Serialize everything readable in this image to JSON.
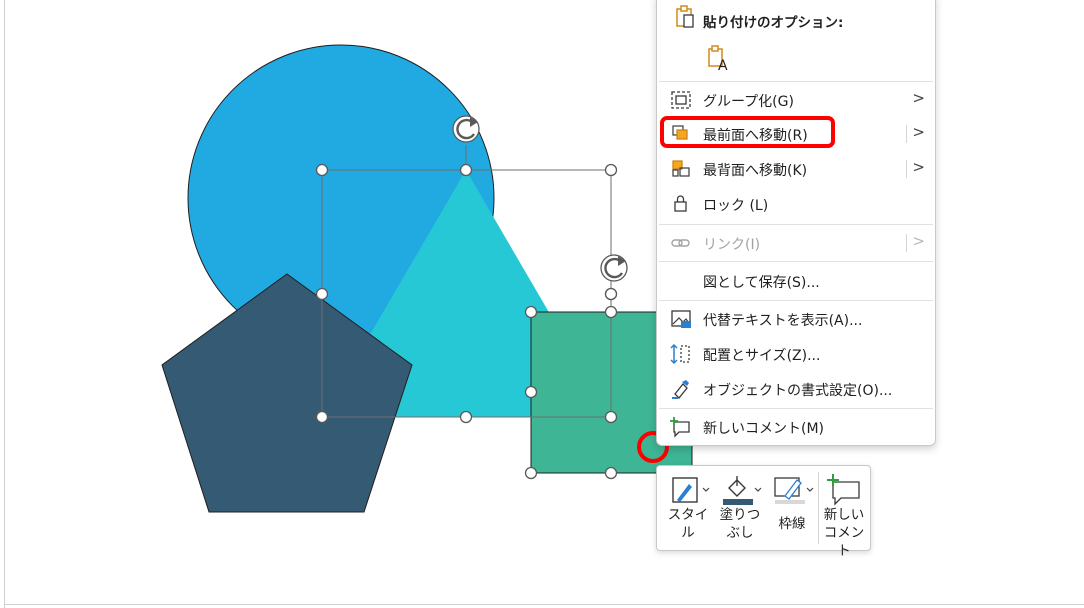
{
  "colors": {
    "circle": "#21A9E1",
    "triangle": "#27C8D6",
    "pentagon": "#345A74",
    "square": "#3EB594",
    "highlight": "#FF0000"
  },
  "shapes": [
    "circle",
    "triangle",
    "pentagon",
    "square"
  ],
  "context_menu": {
    "paste_options_title": "貼り付けのオプション:",
    "paste_icon": "paste-keep-text-icon",
    "items": [
      {
        "label": "グループ化(G)",
        "icon": "group-icon",
        "submenu": true,
        "split": false
      },
      {
        "label": "最前面へ移動(R)",
        "icon": "bring-to-front-icon",
        "submenu": true,
        "split": true,
        "highlighted": true
      },
      {
        "label": "最背面へ移動(K)",
        "icon": "send-to-back-icon",
        "submenu": true,
        "split": true
      },
      {
        "label": "ロック (L)",
        "icon": "lock-icon",
        "submenu": false
      },
      {
        "label": "リンク(I)",
        "icon": "link-icon",
        "submenu": true,
        "split": true,
        "disabled": true
      },
      {
        "label": "図として保存(S)...",
        "icon": "",
        "submenu": false
      },
      {
        "label": "代替テキストを表示(A)...",
        "icon": "alt-text-icon",
        "submenu": false
      },
      {
        "label": "配置とサイズ(Z)...",
        "icon": "size-position-icon",
        "submenu": false
      },
      {
        "label": "オブジェクトの書式設定(O)...",
        "icon": "format-object-icon",
        "submenu": false
      },
      {
        "label": "新しいコメント(M)",
        "icon": "new-comment-icon",
        "submenu": false
      }
    ]
  },
  "mini_toolbar": {
    "style_label": "スタイ\nル",
    "fill_label": "塗りつ\nぶし",
    "outline_label": "枠線",
    "comment_label": "新しい\nコメント"
  }
}
